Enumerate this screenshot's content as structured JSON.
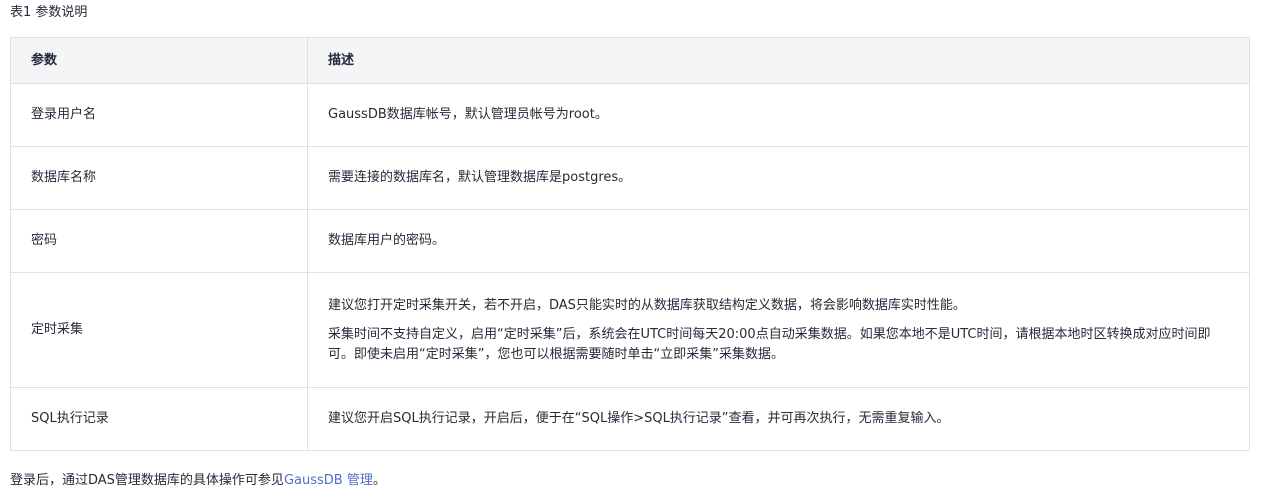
{
  "caption": "表1 参数说明",
  "table": {
    "headers": [
      "参数",
      "描述"
    ],
    "rows": [
      {
        "param": "登录用户名",
        "desc": [
          "GaussDB数据库帐号，默认管理员帐号为root。"
        ]
      },
      {
        "param": "数据库名称",
        "desc": [
          "需要连接的数据库名，默认管理数据库是postgres。"
        ]
      },
      {
        "param": "密码",
        "desc": [
          "数据库用户的密码。"
        ]
      },
      {
        "param": "定时采集",
        "desc": [
          "建议您打开定时采集开关，若不开启，DAS只能实时的从数据库获取结构定义数据，将会影响数据库实时性能。",
          "采集时间不支持自定义，启用“定时采集”后，系统会在UTC时间每天20:00点自动采集数据。如果您本地不是UTC时间，请根据本地时区转换成对应时间即可。即使未启用“定时采集”，您也可以根据需要随时单击“立即采集”采集数据。"
        ]
      },
      {
        "param": "SQL执行记录",
        "desc": [
          "建议您开启SQL执行记录，开启后，便于在“SQL操作>SQL执行记录”查看，并可再次执行，无需重复输入。"
        ]
      }
    ]
  },
  "footer": {
    "text_before": "登录后，通过DAS管理数据库的具体操作可参见",
    "link": "GaussDB 管理",
    "text_after": "。"
  }
}
